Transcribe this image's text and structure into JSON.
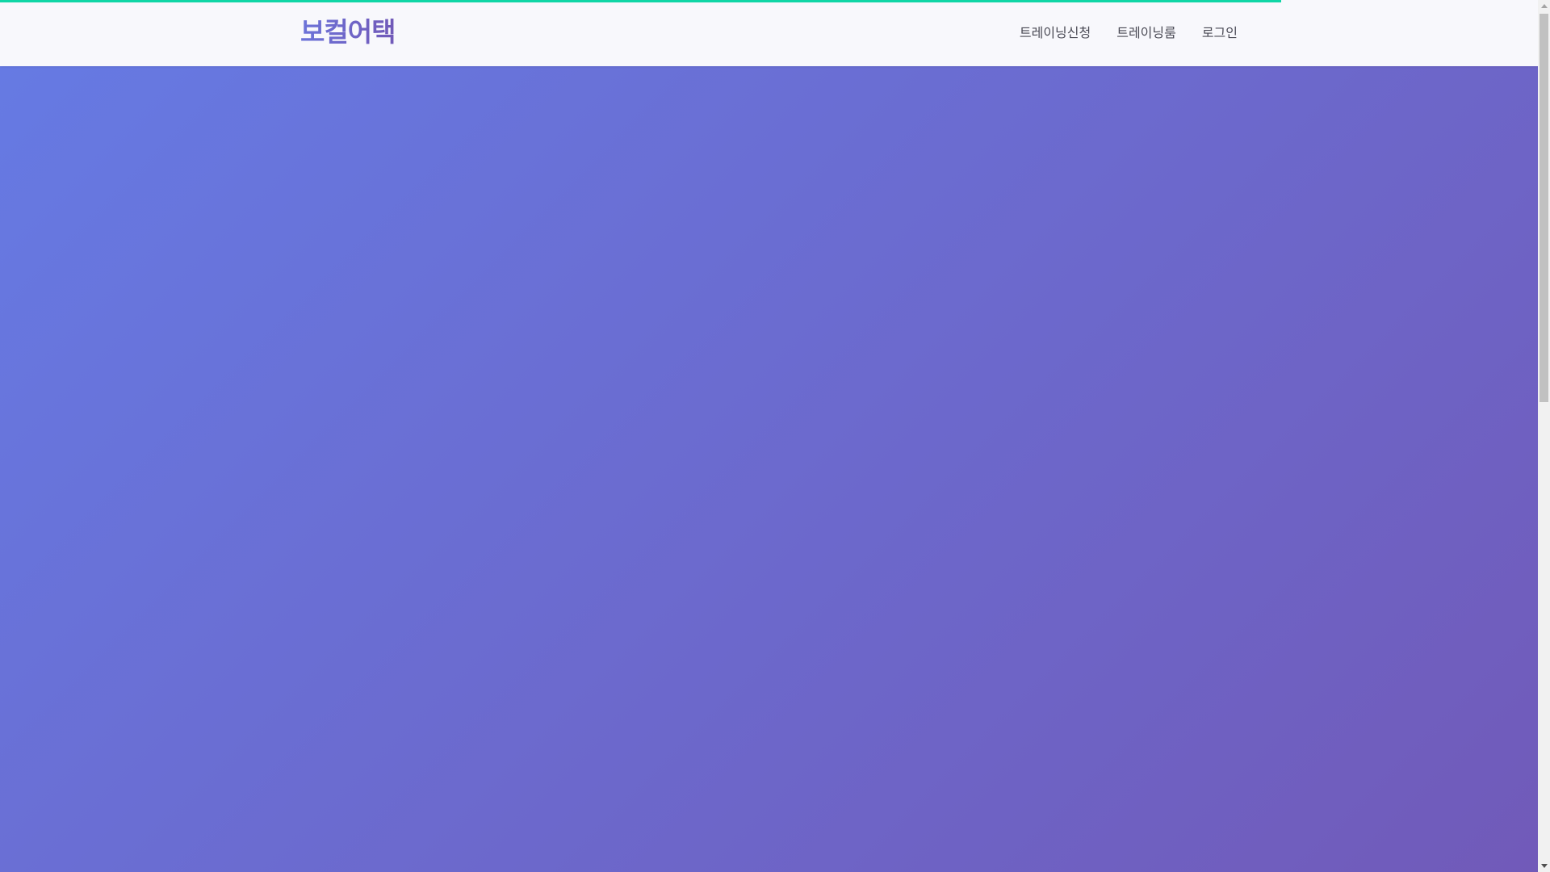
{
  "header": {
    "brand": "보컬어택",
    "nav": [
      {
        "label": "트레이닝신청"
      },
      {
        "label": "트레이닝룸"
      },
      {
        "label": "로그인"
      }
    ]
  },
  "scroll_progress": {
    "fraction": 0.833,
    "color": "#10d6a6"
  },
  "hero": {
    "gradient_start": "#667ae3",
    "gradient_end": "#715ab9"
  },
  "scrollbar": {
    "visible_fraction": 0.46
  }
}
